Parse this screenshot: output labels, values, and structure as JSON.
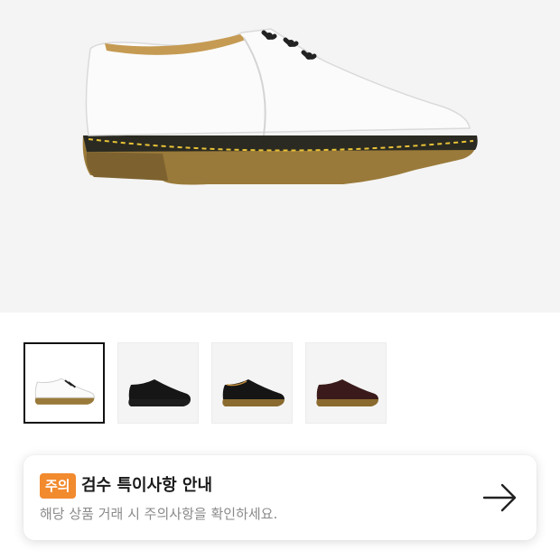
{
  "product": {
    "main_image": "white-leather-derby-shoe",
    "thumbnails": [
      {
        "image": "white-derby-shoe",
        "selected": true
      },
      {
        "image": "black-smooth-derby-shoe",
        "selected": false
      },
      {
        "image": "black-derby-shoe-brown-sole",
        "selected": false
      },
      {
        "image": "burgundy-derby-shoe",
        "selected": false
      }
    ]
  },
  "notice": {
    "badge": "주의",
    "title": "검수 특이사항 안내",
    "subtitle": "해당 상품 거래 시 주의사항을 확인하세요.",
    "arrow_icon": "arrow-right-icon"
  },
  "colors": {
    "badge_bg": "#f28a2e",
    "hero_bg": "#f4f4f4",
    "sole_tan": "#9a7a3a",
    "welt_stitch": "#e8c236"
  }
}
